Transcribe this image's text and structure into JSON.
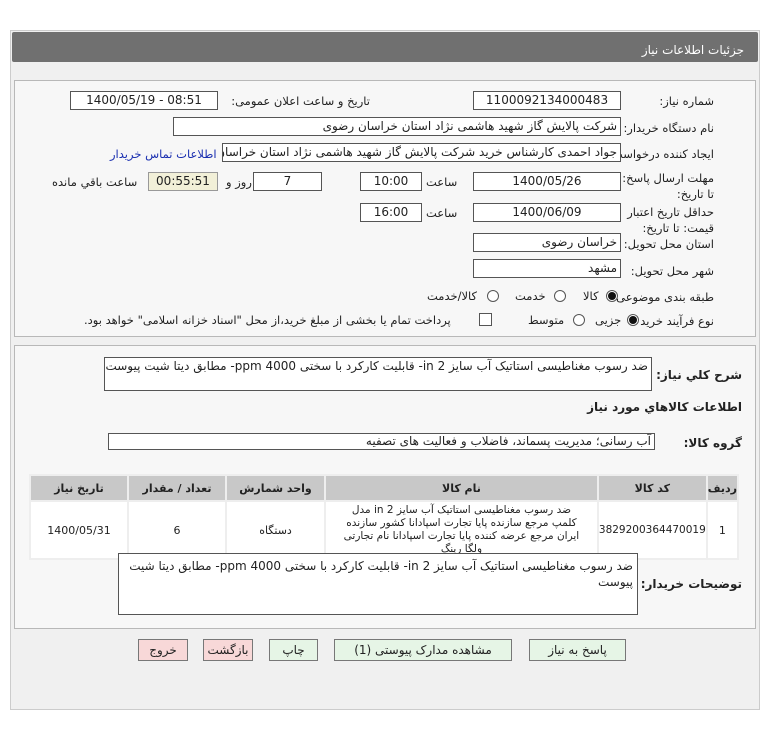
{
  "header": {
    "title": "جزئیات اطلاعات نیاز"
  },
  "form": {
    "need_number_label": "شماره نیاز:",
    "need_number": "1100092134000483",
    "announce_label": "تاریخ و ساعت اعلان عمومی:",
    "announce_value": "1400/05/19 - 08:51",
    "buyer_label": "نام دستگاه خریدار:",
    "buyer_value": "شرکت پالایش گاز شهید هاشمی نژاد   استان خراسان رضوی",
    "creator_label": "ایجاد کننده درخواست:",
    "creator_value": "جواد احمدی کارشناس خرید شرکت پالایش گاز شهید هاشمی نژاد   استان خراسان رضوی",
    "contact_link": "اطلاعات تماس خریدار",
    "deadline_label": "مهلت ارسال پاسخ: تا تاریخ:",
    "deadline_date": "1400/05/26",
    "time_label": "ساعت",
    "deadline_time": "10:00",
    "days": "7",
    "days_label": "روز و",
    "remaining": "00:55:51",
    "remaining_label": "ساعت باقي مانده",
    "validity_label": "حداقل تاریخ اعتبار قیمت: تا تاریخ:",
    "validity_date": "1400/06/09",
    "validity_time": "16:00",
    "province_label": "استان محل تحویل:",
    "province": "خراسان رضوی",
    "city_label": "شهر محل تحویل:",
    "city": "مشهد",
    "category_label": "طبقه بندی موضوعی:",
    "category_options": [
      "کالا",
      "خدمت",
      "کالا/خدمت"
    ],
    "category_selected": "کالا",
    "process_label": "نوع فرآیند خرید :",
    "process_options": [
      "جزیی",
      "متوسط"
    ],
    "process_selected": "جزیی",
    "payment_note": "پرداخت تمام یا بخشی از مبلغ خرید،از محل \"اسناد خزانه اسلامی\" خواهد بود."
  },
  "details": {
    "summary_label": "شرح کلي نياز:",
    "summary": "ضد رسوب مغناطیسی استاتیک آب سایز 2 in- قابلیت کارکرد با سختی 4000 ppm- مطابق دیتا شیت پیوست",
    "goods_title": "اطلاعات کالاهاي مورد نياز",
    "group_label": "گروه کالا:",
    "group_value": "آب رسانی؛ مدیریت پسماند، فاضلاب و فعالیت های تصفیه",
    "table": {
      "headers": [
        "ردیف",
        "کد کالا",
        "نام کالا",
        "واحد شمارش",
        "تعداد / مقدار",
        "تاریخ نیاز"
      ],
      "rows": [
        [
          "1",
          "3829200364470019",
          "ضد رسوب مغناطیسی استاتیک آب سایز 2 in مدل کلمپ مرجع سازنده پایا تجارت اسپادانا کشور سازنده ایران مرجع عرضه کننده پایا تجارت اسپادانا نام تجارتی ولگا رینگ",
          "دستگاه",
          "6",
          "1400/05/31"
        ]
      ]
    },
    "notes_label": "توضیحات خریدار:",
    "notes": "ضد رسوب مغناطیسی استاتیک آب سایز 2 in- قابلیت کارکرد با سختی 4000 ppm- مطابق دیتا شیت پیوست"
  },
  "buttons": {
    "reply": "پاسخ به نیاز",
    "attachments": "مشاهده مدارک پیوستی (1)",
    "print": "چاپ",
    "back": "بازگشت",
    "exit": "خروج"
  }
}
